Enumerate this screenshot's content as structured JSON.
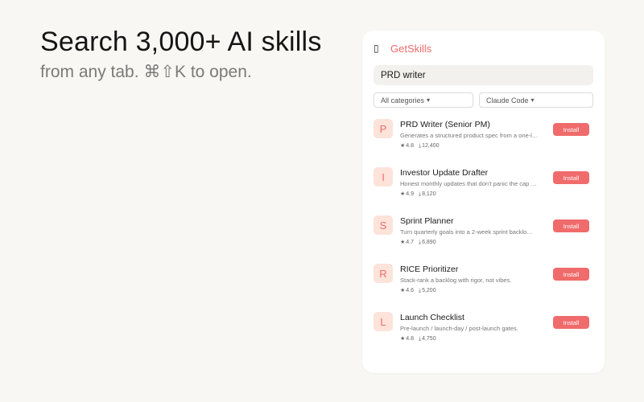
{
  "hero": {
    "title": "Search 3,000+ AI skills",
    "subtitle": "from any tab. ⌘⇧K to open."
  },
  "panel": {
    "app_icon": "▯",
    "app_name": "GetSkills",
    "search_value": "PRD writer",
    "filters": {
      "categories": "All categories",
      "agent": "Claude Code"
    },
    "caret": "▾",
    "rating_icon": "★",
    "installs_icon": "⤓",
    "install_label": "Install",
    "results": [
      {
        "letter": "P",
        "title": "PRD Writer (Senior PM)",
        "desc": "Generates a structured product spec from a one-l…",
        "rating": "4.8",
        "installs": "12,400"
      },
      {
        "letter": "I",
        "title": "Investor Update Drafter",
        "desc": "Honest monthly updates that don't panic the cap …",
        "rating": "4.9",
        "installs": "8,120"
      },
      {
        "letter": "S",
        "title": "Sprint Planner",
        "desc": "Turn quarterly goals into a 2-week sprint backlo…",
        "rating": "4.7",
        "installs": "6,890"
      },
      {
        "letter": "R",
        "title": "RICE Prioritizer",
        "desc": "Stack-rank a backlog with rigor, not vibes.",
        "rating": "4.6",
        "installs": "5,200"
      },
      {
        "letter": "L",
        "title": "Launch Checklist",
        "desc": "Pre-launch / launch-day / post-launch gates.",
        "rating": "4.8",
        "installs": "4,750"
      }
    ]
  },
  "colors": {
    "accent": "#f06b6b",
    "avatar_bg": "#fde3d9",
    "page_bg": "#f8f7f4"
  }
}
